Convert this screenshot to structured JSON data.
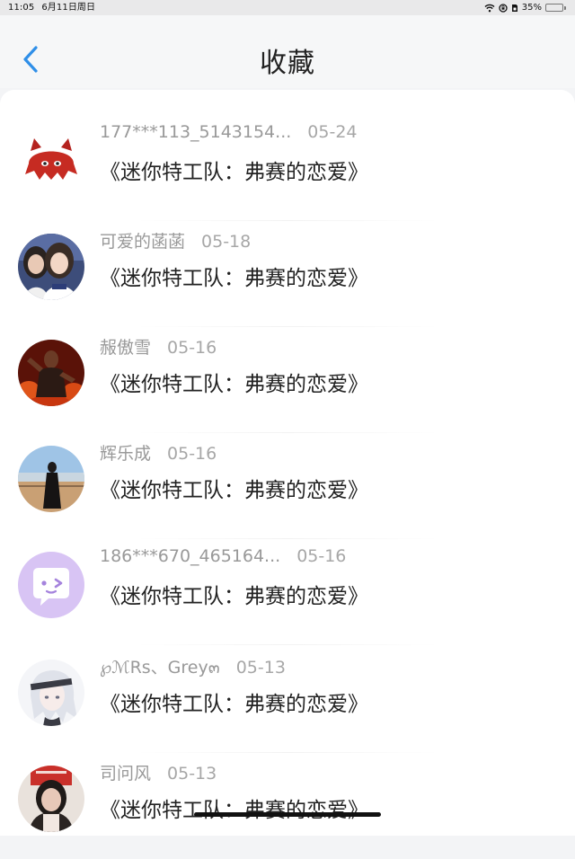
{
  "status_bar": {
    "time": "11:05",
    "date": "6月11日周日",
    "battery": "35%",
    "battery_level": 0.35,
    "icons": [
      "wifi-icon",
      "lock-rotation-icon",
      "sim-icon",
      "battery-icon"
    ]
  },
  "header": {
    "title": "收藏",
    "back_icon": "chevron-left-icon",
    "accent_color": "#2f8fe8"
  },
  "favorites": [
    {
      "user": "177***113_5143154...",
      "date": "05-24",
      "title": "《迷你特工队：弗赛的恋爱》",
      "avatar": "red-cat-avatar"
    },
    {
      "user": "可爱的菡菡",
      "date": "05-18",
      "title": "《迷你特工队：弗赛的恋爱》",
      "avatar": "two-girls-photo-avatar"
    },
    {
      "user": "赧傲雪",
      "date": "05-16",
      "title": "《迷你特工队：弗赛的恋爱》",
      "avatar": "man-on-fire-photo-avatar"
    },
    {
      "user": "辉乐成",
      "date": "05-16",
      "title": "《迷你特工队：弗赛的恋爱》",
      "avatar": "landscape-photo-avatar"
    },
    {
      "user": "186***670_465164...",
      "date": "05-16",
      "title": "《迷你特工队：弗赛的恋爱》",
      "avatar": "purple-chat-avatar"
    },
    {
      "user": "℘ℳRs、Grey๓",
      "date": "05-13",
      "title": "《迷你特工队：弗赛的恋爱》",
      "avatar": "anime-white-hair-avatar"
    },
    {
      "user": "司问风",
      "date": "05-13",
      "title": "《迷你特工队：弗赛的恋爱》",
      "avatar": "girl-red-sign-photo-avatar"
    }
  ]
}
